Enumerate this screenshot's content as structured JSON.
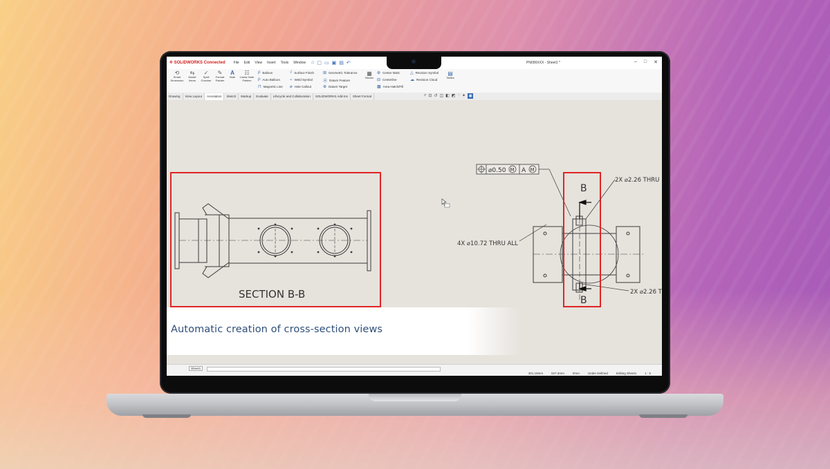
{
  "app": {
    "logo_text": "SOLIDWORKS Connected",
    "menus": [
      "File",
      "Edit",
      "View",
      "Insert",
      "Tools",
      "Window"
    ],
    "document_title": "PN000XXX - Sheet1 *",
    "window_controls": [
      "minimize-icon",
      "maximize-icon",
      "close-icon"
    ]
  },
  "ribbon": {
    "big_buttons": [
      {
        "label": "Smart Dimension",
        "icon": "smart-dimension-icon"
      },
      {
        "label": "Model Items",
        "icon": "model-items-icon"
      },
      {
        "label": "Spell Checker",
        "icon": "spell-checker-icon"
      },
      {
        "label": "Format Painter",
        "icon": "format-painter-icon"
      },
      {
        "label": "Note",
        "icon": "note-icon"
      },
      {
        "label": "Linear Note Pattern",
        "icon": "linear-note-pattern-icon"
      }
    ],
    "col1": [
      "Balloon",
      "Auto Balloon",
      "Magnetic Line"
    ],
    "col2": [
      "Surface Finish",
      "Weld Symbol",
      "Hole Callout"
    ],
    "col3": [
      "Geometric Tolerance",
      "Datum Feature",
      "Datum Target"
    ],
    "blocks_label": "Blocks",
    "col4": [
      "Center Mark",
      "Centerline",
      "Area Hatch/Fill"
    ],
    "col5": [
      "Revision Symbol",
      "Revision Cloud"
    ],
    "tables_label": "Tables"
  },
  "tabs": [
    "Drawing",
    "View Layout",
    "Annotation",
    "Sketch",
    "Markup",
    "Evaluate",
    "Lifecycle and Collaboration",
    "SOLIDWORKS Add-Ins",
    "Sheet Format"
  ],
  "active_tab": "Annotation",
  "drawing": {
    "section_label": "SECTION B-B",
    "gtol_value": "⌀0.50",
    "gtol_mod1": "M",
    "gtol_datum": "A",
    "gtol_mod2": "M",
    "section_letter_top": "B",
    "section_letter_bottom": "B",
    "callout_top": "2X ⌀2.26 THRU",
    "callout_bottom": "2X ⌀2.26 T",
    "callout_left": "4X ⌀10.72 THRU ALL"
  },
  "caption": "Automatic creation of cross-section views",
  "status": {
    "sheet_tab": "Sheet1",
    "items": [
      "301.18mm",
      "627.3mm",
      "0mm",
      "Under Defined",
      "Editing Sheet1",
      "1 : 5"
    ]
  },
  "colors": {
    "highlight_red": "#e02424",
    "caption_blue": "#2f4f7a",
    "line_gray": "#3a3a3a"
  }
}
